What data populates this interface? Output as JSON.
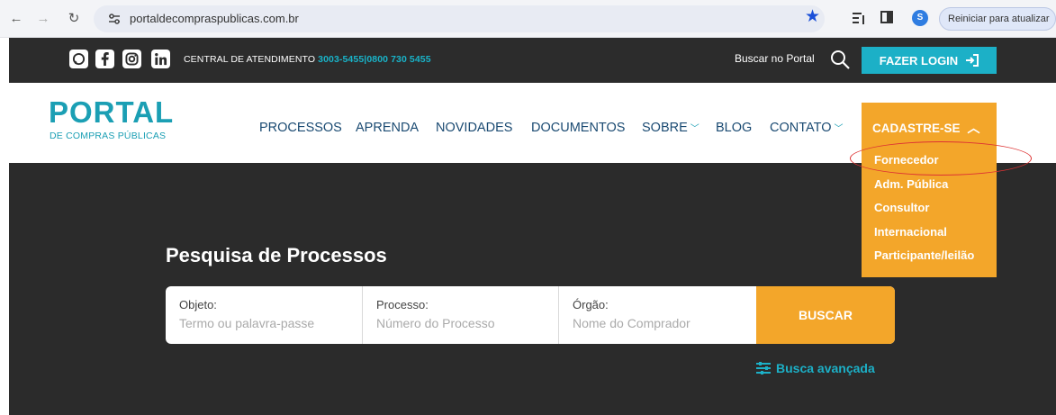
{
  "browser": {
    "url": "portaldecompraspublicas.com.br",
    "restart_label": "Reiniciar para atualizar",
    "profile_initial": "S"
  },
  "topbar": {
    "social_icons": [
      "whatsapp-icon",
      "facebook-icon",
      "instagram-icon",
      "linkedin-icon"
    ],
    "central_label": "CENTRAL DE ATENDIMENTO",
    "phone_1": "3003-5455",
    "phone_sep": "|",
    "phone_2": "0800 730 5455",
    "search_label": "Buscar no Portal",
    "login_label": "FAZER LOGIN"
  },
  "logo": {
    "main": "PORTAL",
    "sub": "DE COMPRAS PÚBLICAS"
  },
  "nav": {
    "items": [
      "PROCESSOS",
      "APRENDA",
      "NOVIDADES",
      "DOCUMENTOS",
      "SOBRE",
      "BLOG",
      "CONTATO"
    ],
    "cadastre_label": "CADASTRE-SE"
  },
  "dropdown": {
    "items": [
      "Fornecedor",
      "Adm. Pública",
      "Consultor",
      "Internacional",
      "Participante/leilão"
    ]
  },
  "hero": {
    "title": "Pesquisa de Processos",
    "fields": [
      {
        "label": "Objeto:",
        "placeholder": "Termo ou palavra-passe"
      },
      {
        "label": "Processo:",
        "placeholder": "Número do Processo"
      },
      {
        "label": "Órgão:",
        "placeholder": "Nome do Comprador"
      }
    ],
    "buscar_label": "BUSCAR",
    "advanced_label": "Busca avançada"
  },
  "colors": {
    "brand_teal": "#1cb0c7",
    "brand_orange": "#f3a62a",
    "dark_bg": "#2b2b2b",
    "nav_text": "#1a4a72"
  }
}
